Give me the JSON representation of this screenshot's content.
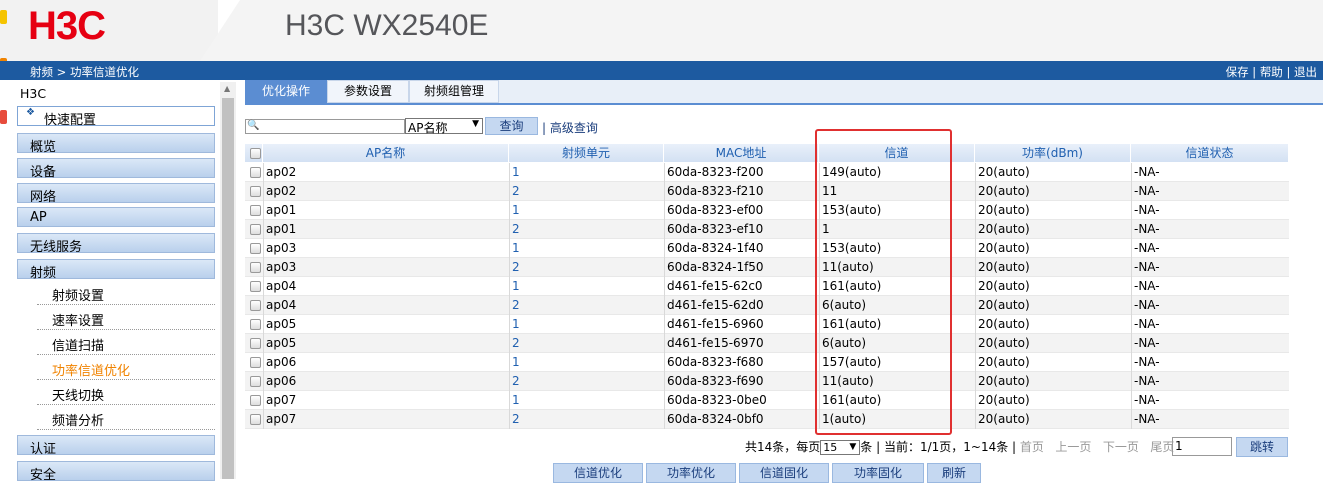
{
  "header": {
    "logo": "H3C",
    "product": "H3C WX2540E"
  },
  "topbar": {
    "breadcrumb": "射频 > 功率信道优化",
    "save": "保存",
    "help": "帮助",
    "logout": "退出"
  },
  "sidebar": {
    "root": "H3C",
    "quick": "快速配置",
    "items": [
      "概览",
      "设备",
      "网络",
      "AP",
      "无线服务",
      "射频"
    ],
    "sub_items": [
      "射频设置",
      "速率设置",
      "信道扫描",
      "功率信道优化",
      "天线切换",
      "频谱分析"
    ],
    "bottom_items": [
      "认证",
      "安全"
    ]
  },
  "tabs": [
    "优化操作",
    "参数设置",
    "射频组管理"
  ],
  "search": {
    "placeholder": "",
    "field": "AP名称",
    "button": "查询",
    "advanced": "高级查询"
  },
  "table": {
    "columns": [
      "AP名称",
      "射频单元",
      "MAC地址",
      "信道",
      "功率(dBm)",
      "信道状态"
    ],
    "rows": [
      [
        "ap02",
        "1",
        "60da-8323-f200",
        "149(auto)",
        "20(auto)",
        "-NA-"
      ],
      [
        "ap02",
        "2",
        "60da-8323-f210",
        "11",
        "20(auto)",
        "-NA-"
      ],
      [
        "ap01",
        "1",
        "60da-8323-ef00",
        "153(auto)",
        "20(auto)",
        "-NA-"
      ],
      [
        "ap01",
        "2",
        "60da-8323-ef10",
        "1",
        "20(auto)",
        "-NA-"
      ],
      [
        "ap03",
        "1",
        "60da-8324-1f40",
        "153(auto)",
        "20(auto)",
        "-NA-"
      ],
      [
        "ap03",
        "2",
        "60da-8324-1f50",
        "11(auto)",
        "20(auto)",
        "-NA-"
      ],
      [
        "ap04",
        "1",
        "d461-fe15-62c0",
        "161(auto)",
        "20(auto)",
        "-NA-"
      ],
      [
        "ap04",
        "2",
        "d461-fe15-62d0",
        "6(auto)",
        "20(auto)",
        "-NA-"
      ],
      [
        "ap05",
        "1",
        "d461-fe15-6960",
        "161(auto)",
        "20(auto)",
        "-NA-"
      ],
      [
        "ap05",
        "2",
        "d461-fe15-6970",
        "6(auto)",
        "20(auto)",
        "-NA-"
      ],
      [
        "ap06",
        "1",
        "60da-8323-f680",
        "157(auto)",
        "20(auto)",
        "-NA-"
      ],
      [
        "ap06",
        "2",
        "60da-8323-f690",
        "11(auto)",
        "20(auto)",
        "-NA-"
      ],
      [
        "ap07",
        "1",
        "60da-8323-0be0",
        "161(auto)",
        "20(auto)",
        "-NA-"
      ],
      [
        "ap07",
        "2",
        "60da-8324-0bf0",
        "1(auto)",
        "20(auto)",
        "-NA-"
      ]
    ]
  },
  "pager": {
    "total": "共14条，每页",
    "per_page": "15",
    "current": "条 | 当前：1/1页，1~14条 |",
    "first": "首页",
    "prev": "上一页",
    "next": "下一页",
    "last": "尾页",
    "page_value": "1",
    "jump": "跳转"
  },
  "actions": [
    "信道优化",
    "功率优化",
    "信道固化",
    "功率固化",
    "刷新"
  ],
  "colors": {
    "brand_red": "#e60012",
    "bar_blue": "#1d5aa0",
    "highlight": "#e03030",
    "active_item": "#f08300"
  }
}
